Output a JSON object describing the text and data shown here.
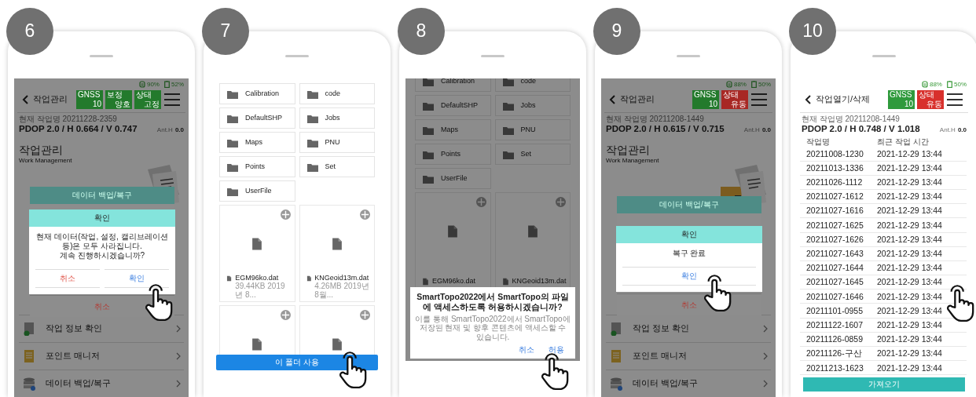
{
  "steps": [
    {
      "number": "6",
      "kind": "menu",
      "status": {
        "receiver": "90%",
        "battery": "52%"
      },
      "header": {
        "title": "작업관리",
        "badges": [
          {
            "label": "GNSS",
            "value": "10",
            "color": "#237a2c"
          },
          {
            "label": "보정",
            "value": "양호",
            "color": "#237a2c"
          },
          {
            "label": "상태",
            "value": "고정",
            "color": "#237a2c"
          }
        ]
      },
      "job": "현재 작업명 20211228-2359",
      "dop": "PDOP 2.0 / H 0.664 / V 0.747",
      "ant_label": "Ant.H",
      "ant_value": "0.0",
      "section": {
        "title": "작업관리",
        "subtitle": "Work Management"
      },
      "menu_items": [
        {
          "label": "작업 정보 확인",
          "kind": "info"
        },
        {
          "label": "포인트 매니저",
          "kind": "points"
        },
        {
          "label": "데이터 백업/복구",
          "kind": "backup"
        }
      ],
      "dialog": {
        "title": "데이터 백업/복구",
        "cancel": "취소",
        "confirm": {
          "title": "확인",
          "message": "현재 데이터(작업, 설정, 캘리브레이션 등)은 모두 사라집니다.\n계속 진행하시겠습니까?",
          "buttons": [
            {
              "label": "취소",
              "kind": "cancel"
            },
            {
              "label": "확인",
              "kind": "ok"
            }
          ]
        }
      }
    },
    {
      "number": "7",
      "kind": "files",
      "dimmed": false,
      "folders": [
        "Calibration",
        "code",
        "DefaultSHP",
        "Jobs",
        "Maps",
        "PNU",
        "Points",
        "Set",
        "UserFile"
      ],
      "files": [
        {
          "kind": "full",
          "name": "EGM96ko.dat",
          "meta": "39.44KB 2019년 8..."
        },
        {
          "kind": "full",
          "name": "KNGeoid13m.dat",
          "meta": "4.26MB 2019년 8월..."
        },
        {
          "kind": "partial"
        },
        {
          "kind": "partial"
        }
      ],
      "button": "이 폴더 사용"
    },
    {
      "number": "8",
      "kind": "files",
      "dimmed": true,
      "folders": [
        "Calibration",
        "code",
        "DefaultSHP",
        "Jobs",
        "Maps",
        "PNU",
        "Points",
        "Set",
        "UserFile"
      ],
      "files": [
        {
          "kind": "full",
          "name": "EGM96ko.dat"
        },
        {
          "kind": "full",
          "name": "KNGeoid13m.dat"
        }
      ],
      "permission": {
        "title": "SmartTopo2022에서 SmartTopo의 파일에 액세스하도록 허용하시겠습니까?",
        "message": "이를 통해 SmartTopo2022에서 SmartTopo에 저장된 현재 및 향후 콘텐츠에 액세스할 수 있습니다.",
        "buttons": [
          "취소",
          "허용"
        ]
      }
    },
    {
      "number": "9",
      "kind": "menu",
      "status": {
        "receiver": "88%",
        "battery": "50%"
      },
      "header": {
        "title": "작업관리",
        "badges": [
          {
            "label": "GNSS",
            "value": "10",
            "color": "#237a2c"
          },
          {
            "label": "상태",
            "value": "유동",
            "color": "#a82824"
          }
        ]
      },
      "job": "현재 작업명 20211208-1449",
      "dop": "PDOP 2.0 / H 0.615 / V 0.715",
      "ant_label": "Ant.H",
      "ant_value": "0.0",
      "section": {
        "title": "작업관리",
        "subtitle": "Work Management"
      },
      "menu_items": [
        {
          "label": "작업 정보 확인",
          "kind": "info"
        },
        {
          "label": "포인트 매니저",
          "kind": "points"
        },
        {
          "label": "데이터 백업/복구",
          "kind": "backup"
        }
      ],
      "dialog": {
        "title": "데이터 백업/복구",
        "cancel": "취소",
        "confirm": {
          "title": "확인",
          "message": "복구 완료",
          "buttons": [
            {
              "label": "확인",
              "kind": "ok"
            }
          ]
        }
      }
    },
    {
      "number": "10",
      "kind": "jobs",
      "status": {
        "receiver": "88%",
        "battery": "50%"
      },
      "header": {
        "title": "작업열기/삭제",
        "badges": [
          {
            "label": "GNSS",
            "value": "10",
            "color": "#2f9a3c"
          },
          {
            "label": "상태",
            "value": "유동",
            "color": "#d8302c"
          }
        ]
      },
      "job": "현재 작업명 20211208-1449",
      "dop": "PDOP 2.0 / H 0.748 / V 1.018",
      "ant_label": "Ant.H",
      "ant_value": "0.0",
      "columns": [
        "작업명",
        "최근 작업 시간"
      ],
      "rows": [
        [
          "20211008-1230",
          "2021-12-29 13:44"
        ],
        [
          "20211013-1336",
          "2021-12-29 13:44"
        ],
        [
          "20211026-1112",
          "2021-12-29 13:44"
        ],
        [
          "20211027-1612",
          "2021-12-29 13:44"
        ],
        [
          "20211027-1616",
          "2021-12-29 13:44"
        ],
        [
          "20211027-1625",
          "2021-12-29 13:44"
        ],
        [
          "20211027-1626",
          "2021-12-29 13:44"
        ],
        [
          "20211027-1643",
          "2021-12-29 13:44"
        ],
        [
          "20211027-1644",
          "2021-12-29 13:44"
        ],
        [
          "20211027-1645",
          "2021-12-29 13:44"
        ],
        [
          "20211027-1646",
          "2021-12-29 13:44"
        ],
        [
          "20211101-0955",
          "2021-12-29 13:44"
        ],
        [
          "20211122-1607",
          "2021-12-29 13:44"
        ],
        [
          "20211126-0859",
          "2021-12-29 13:44"
        ],
        [
          "20211126-구산",
          "2021-12-29 13:44"
        ],
        [
          "20211213-1623",
          "2021-12-29 13:44"
        ]
      ],
      "button": "가져오기"
    }
  ]
}
